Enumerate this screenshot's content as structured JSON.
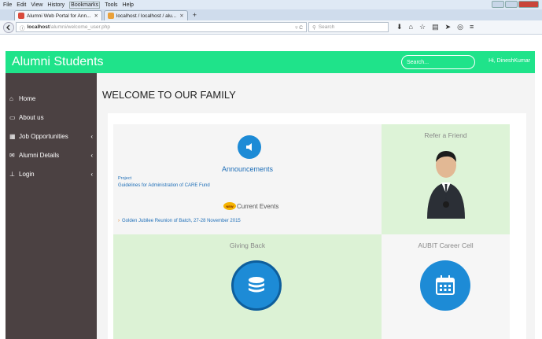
{
  "browser": {
    "menu": [
      "File",
      "Edit",
      "View",
      "History",
      "Bookmarks",
      "Tools",
      "Help"
    ],
    "tabs": [
      {
        "label": "Alumni Web Portal for Ann...",
        "active": true
      },
      {
        "label": "localhost / localhost / alu...",
        "active": false
      }
    ],
    "new_tab": "+",
    "url": {
      "host": "localhost",
      "path": "/alumni/welcome_user.php"
    },
    "search_placeholder": "Search"
  },
  "app": {
    "title": "Alumni Students",
    "search_placeholder": "Search...",
    "greeting": "Hi, DineshKumar"
  },
  "sidebar": {
    "items": [
      {
        "label": "Home",
        "icon": "home-icon",
        "has_children": false
      },
      {
        "label": "About us",
        "icon": "monitor-icon",
        "has_children": false
      },
      {
        "label": "Job Opportunities",
        "icon": "table-icon",
        "has_children": true
      },
      {
        "label": "Alumni Details",
        "icon": "envelope-icon",
        "has_children": true
      },
      {
        "label": "Login",
        "icon": "sitemap-icon",
        "has_children": true
      }
    ]
  },
  "main": {
    "title": "WELCOME TO OUR FAMILY",
    "announcements": {
      "title": "Announcements",
      "project_label": "Project",
      "project_link": "Guidelines for Administration of CARE Fund",
      "events_title": "Current Events",
      "new_badge": "NEW",
      "event_link": "Golden Jubilee Reunion of Batch, 27-28 November 2015"
    },
    "refer": {
      "title": "Refer a Friend"
    },
    "giving": {
      "title": "Giving Back"
    },
    "aubit": {
      "title": "AUBIT Career Cell"
    }
  },
  "colors": {
    "accent": "#1fe38a",
    "sidebar": "#4b4142",
    "icon_blue": "#1d8bd6"
  }
}
